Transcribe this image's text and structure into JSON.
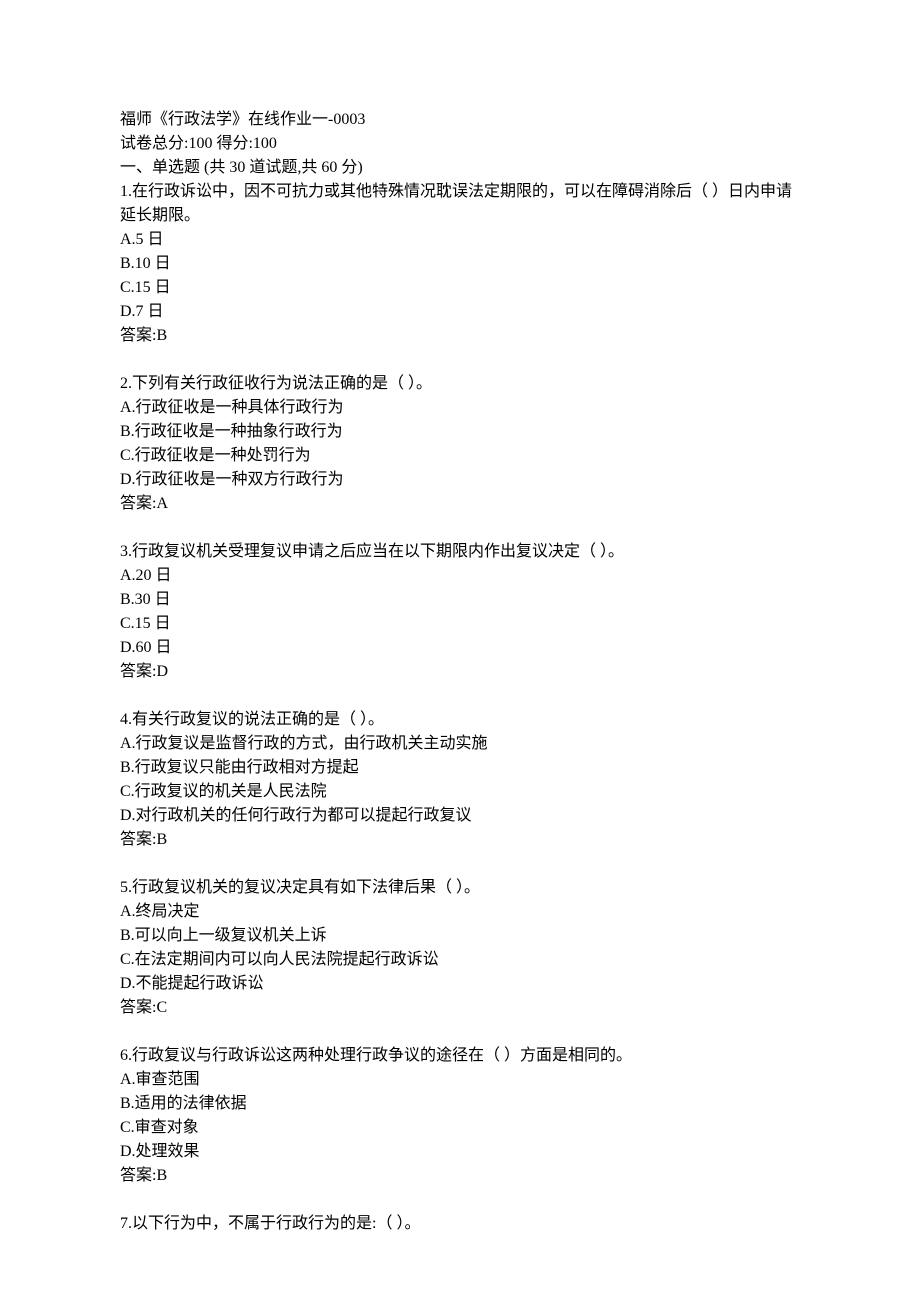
{
  "header": {
    "title": "福师《行政法学》在线作业一-0003",
    "score_line": "试卷总分:100  得分:100",
    "section_title": "一、单选题 (共 30 道试题,共 60 分)"
  },
  "questions": [
    {
      "stem": "1.在行政诉讼中，因不可抗力或其他特殊情况耽误法定期限的，可以在障碍消除后（ ）日内申请延长期限。",
      "options": [
        "A.5 日",
        "B.10 日",
        "C.15 日",
        "D.7 日"
      ],
      "answer": "答案:B"
    },
    {
      "stem": "2.下列有关行政征收行为说法正确的是（ ）。",
      "options": [
        "A.行政征收是一种具体行政行为",
        "B.行政征收是一种抽象行政行为",
        "C.行政征收是一种处罚行为",
        "D.行政征收是一种双方行政行为"
      ],
      "answer": "答案:A"
    },
    {
      "stem": "3.行政复议机关受理复议申请之后应当在以下期限内作出复议决定（ ）。",
      "options": [
        "A.20 日",
        "B.30 日",
        "C.15 日",
        "D.60 日"
      ],
      "answer": "答案:D"
    },
    {
      "stem": "4.有关行政复议的说法正确的是（ ）。",
      "options": [
        "A.行政复议是监督行政的方式，由行政机关主动实施",
        "B.行政复议只能由行政相对方提起",
        "C.行政复议的机关是人民法院",
        "D.对行政机关的任何行政行为都可以提起行政复议"
      ],
      "answer": "答案:B"
    },
    {
      "stem": "5.行政复议机关的复议决定具有如下法律后果（ ）。",
      "options": [
        "A.终局决定",
        "B.可以向上一级复议机关上诉",
        "C.在法定期间内可以向人民法院提起行政诉讼",
        "D.不能提起行政诉讼"
      ],
      "answer": "答案:C"
    },
    {
      "stem": "6.行政复议与行政诉讼这两种处理行政争议的途径在（ ）方面是相同的。",
      "options": [
        "A.审查范围",
        "B.适用的法律依据",
        "C.审查对象",
        "D.处理效果"
      ],
      "answer": "答案:B"
    },
    {
      "stem": "7.以下行为中，不属于行政行为的是:（ ）。",
      "options": [],
      "answer": ""
    }
  ]
}
